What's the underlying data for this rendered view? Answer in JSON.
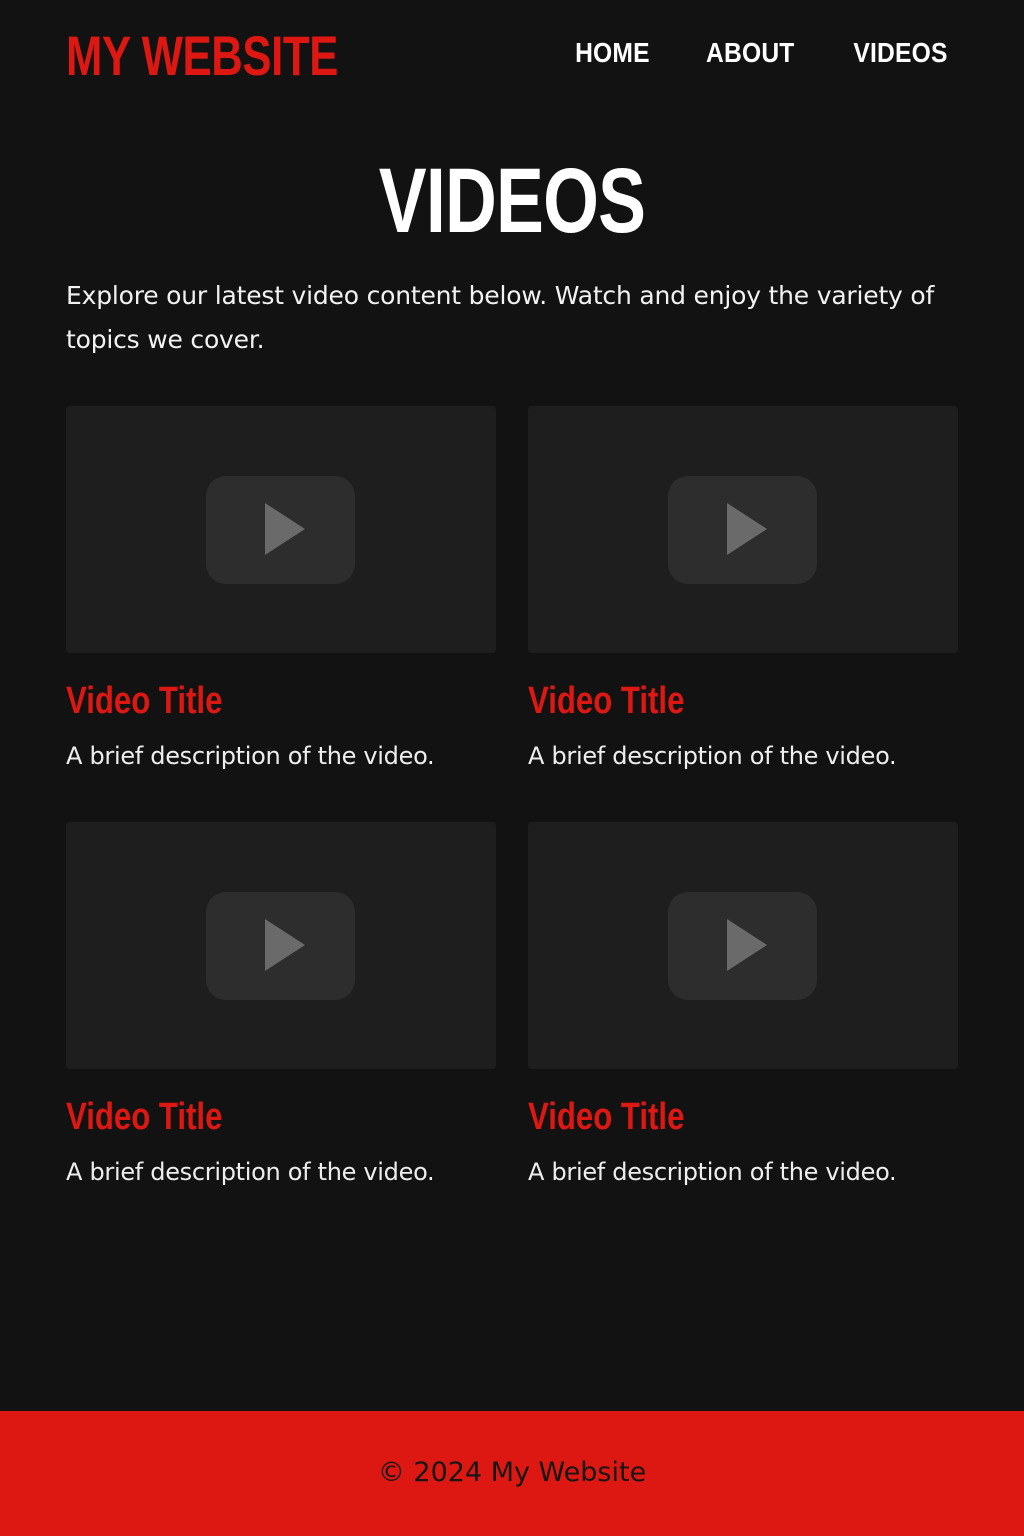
{
  "colors": {
    "accent": "#dd1812",
    "background": "#121212",
    "card_background": "#1e1e1e",
    "play_button_bg": "#2d2d2d",
    "play_icon": "#6a6a6a",
    "text": "#ffffff"
  },
  "header": {
    "logo": "MY WEBSITE",
    "nav": [
      {
        "label": "HOME"
      },
      {
        "label": "ABOUT"
      },
      {
        "label": "VIDEOS"
      }
    ]
  },
  "main": {
    "title": "VIDEOS",
    "intro": "Explore our latest video content below. Watch and enjoy the variety of topics we cover.",
    "videos": [
      {
        "title": "Video Title",
        "description": "A brief description of the video.",
        "icon": "play-icon"
      },
      {
        "title": "Video Title",
        "description": "A brief description of the video.",
        "icon": "play-icon"
      },
      {
        "title": "Video Title",
        "description": "A brief description of the video.",
        "icon": "play-icon"
      },
      {
        "title": "Video Title",
        "description": "A brief description of the video.",
        "icon": "play-icon"
      }
    ]
  },
  "footer": {
    "text": "© 2024 My Website"
  }
}
